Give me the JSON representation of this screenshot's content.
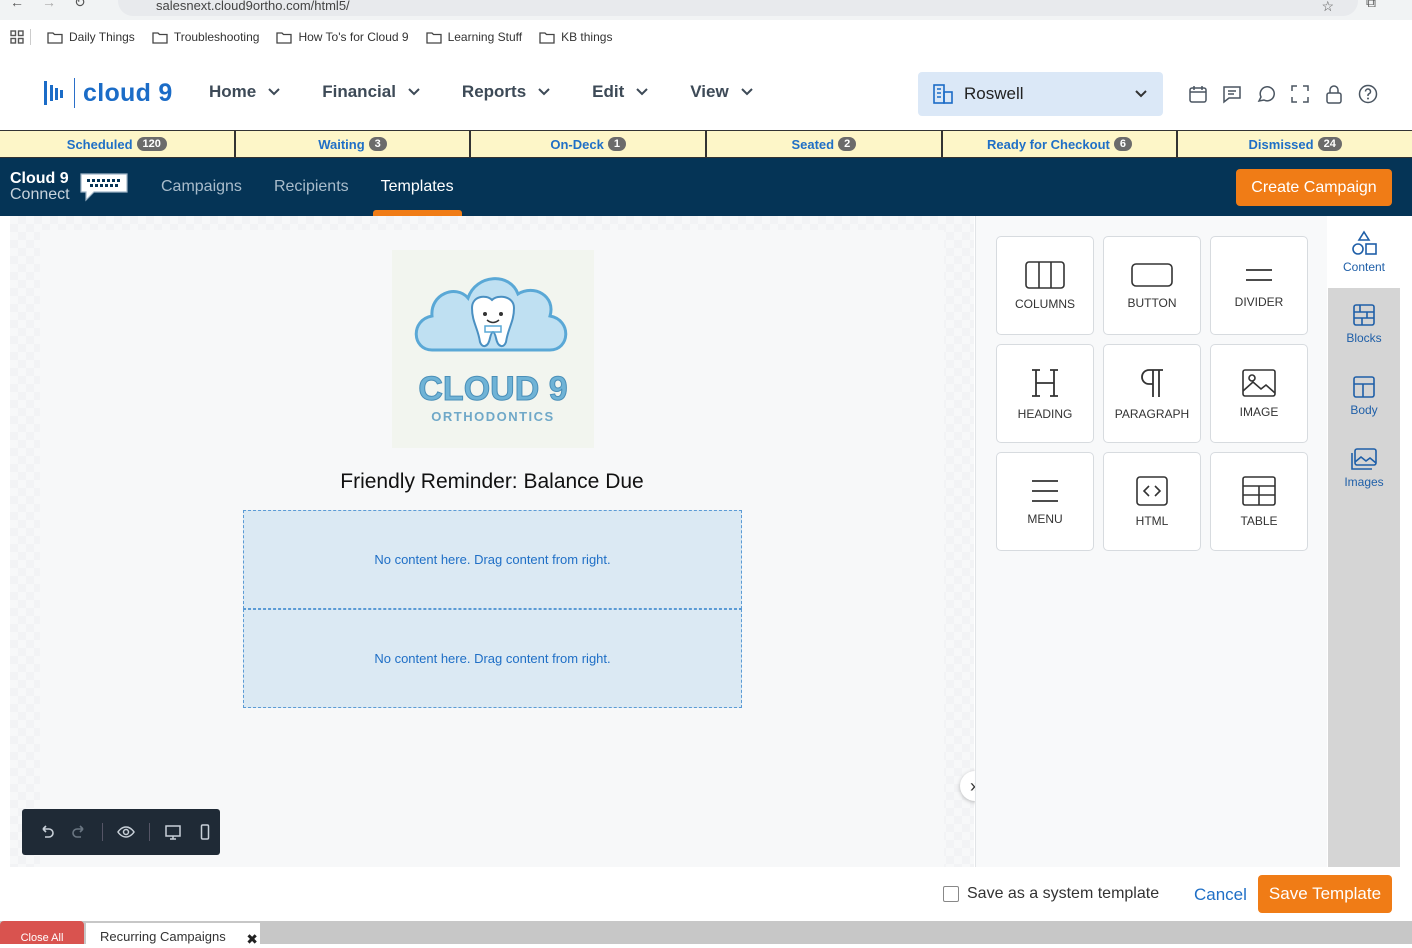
{
  "browser": {
    "url": "salesnext.cloud9ortho.com/html5/",
    "bookmarks": [
      "Daily Things",
      "Troubleshooting",
      "How To's for Cloud 9",
      "Learning Stuff",
      "KB things"
    ]
  },
  "header": {
    "logo_text": "cloud 9",
    "nav": [
      "Home",
      "Financial",
      "Reports",
      "Edit",
      "View"
    ],
    "location": "Roswell"
  },
  "status": [
    {
      "label": "Scheduled",
      "count": "120"
    },
    {
      "label": "Waiting",
      "count": "3"
    },
    {
      "label": "On-Deck",
      "count": "1"
    },
    {
      "label": "Seated",
      "count": "2"
    },
    {
      "label": "Ready for Checkout",
      "count": "6"
    },
    {
      "label": "Dismissed",
      "count": "24"
    }
  ],
  "connect": {
    "logo_line1": "Cloud 9",
    "logo_line2": "Connect",
    "tabs": [
      "Campaigns",
      "Recipients",
      "Templates"
    ],
    "active_tab": "Templates",
    "create_label": "Create Campaign"
  },
  "editor": {
    "logo_text": "CLOUD 9",
    "logo_sub": "ORTHODONTICS",
    "title": "Friendly Reminder: Balance Due",
    "dropzone_text": "No content here. Drag content from right."
  },
  "tools": {
    "row1": [
      "COLUMNS",
      "BUTTON",
      "DIVIDER"
    ],
    "row2": [
      "HEADING",
      "PARAGRAPH",
      "IMAGE"
    ],
    "row3": [
      "MENU",
      "HTML",
      "TABLE"
    ]
  },
  "sidebar": [
    "Content",
    "Blocks",
    "Body",
    "Images"
  ],
  "footer": {
    "system_template_label": "Save as a system template",
    "cancel_label": "Cancel",
    "save_label": "Save Template"
  },
  "bottom": {
    "close_all": "Close All",
    "open_tab": "Recurring Campaigns"
  },
  "colors": {
    "accent": "#f07c16",
    "navy": "#053456",
    "brand_blue": "#1b6cc7",
    "status_bg": "#fdf6c8"
  }
}
